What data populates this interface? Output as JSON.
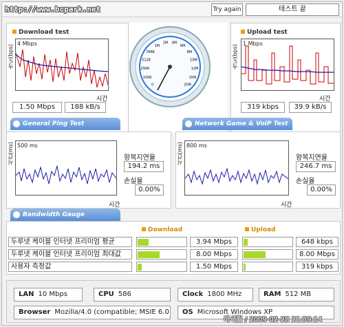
{
  "header": {
    "url": "http://www.bcpark.net",
    "try_again": "Try again",
    "test_end": "테스트 끝"
  },
  "download": {
    "title": "Download test",
    "scale": "4 Mbps",
    "ylabel": "속도(bps)",
    "xlabel": "시간",
    "mbps": "1.50 Mbps",
    "kbs": "188 kB/s"
  },
  "upload": {
    "title": "Upload test",
    "scale": "1 Mbps",
    "ylabel": "속도(bps)",
    "xlabel": "시간",
    "kbps": "319 kbps",
    "kbs": "39.9 kB/s"
  },
  "gauge": {
    "labels": [
      "0",
      "100K",
      "256K",
      "512K",
      "768K",
      "1M",
      "2M",
      "4M",
      "6M",
      "8M",
      "10M",
      "12M",
      "15M",
      "20M"
    ]
  },
  "tabs": {
    "ping": "General Ping Test",
    "game": "Network Game & VoIP Test",
    "bandwidth": "Bandwidth Gauge"
  },
  "ping": {
    "scale": "500 ms",
    "ylabel": "시간(ms)",
    "xlabel": "시간",
    "rtt_label": "왕복지연율",
    "rtt": "194.2 ms",
    "loss_label": "손실율",
    "loss": "0.00%"
  },
  "game": {
    "scale": "800 ms",
    "ylabel": "시간(ms)",
    "xlabel": "시간",
    "rtt_label": "왕복지연율",
    "rtt": "246.7 ms",
    "loss_label": "손실율",
    "loss": "0.00%"
  },
  "bandwidth": {
    "download_header": "Download",
    "upload_header": "Upload",
    "rows": [
      {
        "name": "두루넷 케이블 인터넷 프리미엄 평균",
        "down": "3.94 Mbps",
        "down_frac": 0.22,
        "up": "648 kbps",
        "up_frac": 0.08
      },
      {
        "name": "두루넷 케이블 인터넷 프리미엄 최대값",
        "down": "8.00 Mbps",
        "down_frac": 0.44,
        "up": "8.00 Mbps",
        "up_frac": 0.44
      },
      {
        "name": "사용자 측정값",
        "down": "1.50 Mbps",
        "down_frac": 0.08,
        "up": "319 kbps",
        "up_frac": 0.04
      }
    ]
  },
  "sysinfo": {
    "lan_label": "LAN",
    "lan": "10 Mbps",
    "cpu_label": "CPU",
    "cpu": "586",
    "clock_label": "Clock",
    "clock": "1800 MHz",
    "ram_label": "RAM",
    "ram": "512 MB",
    "browser_label": "Browser",
    "browser": "Mozilla/4.0 (compatible; MSIE 6.0",
    "os_label": "OS",
    "os": "Microsoft Windows XP"
  },
  "watermark": "하세월 / 2009-02-28 21:59:14",
  "colors": {
    "accent": "#f29a00",
    "bar": "#a9d82a",
    "tab": "#5b8ed6",
    "series_red": "#cc0000",
    "series_blue": "#1a1aa8"
  }
}
